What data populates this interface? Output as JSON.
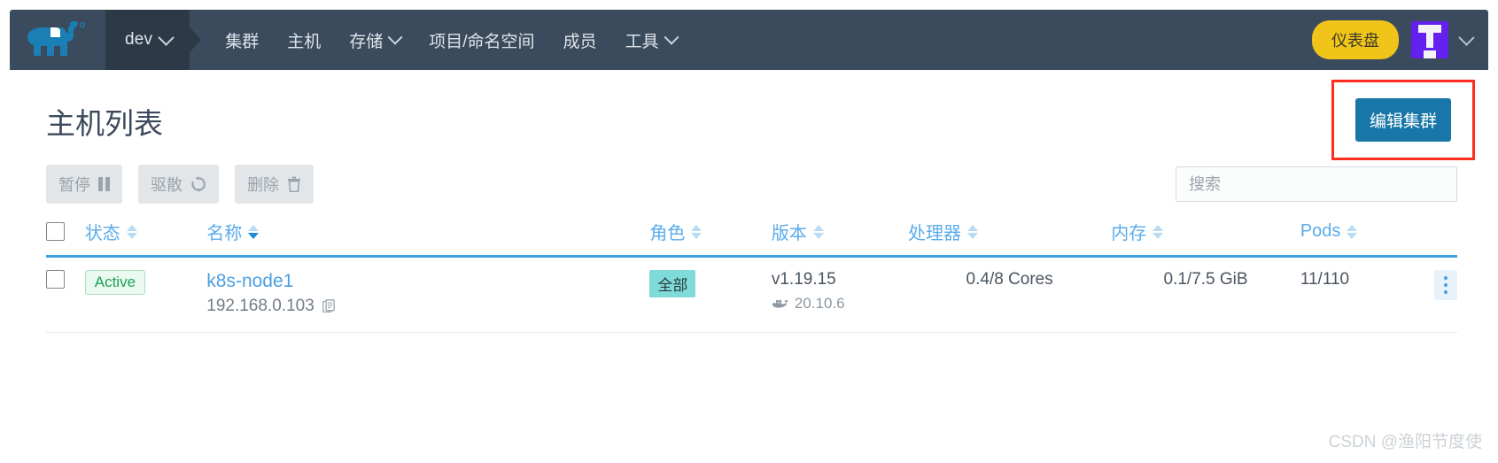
{
  "navbar": {
    "logo_name": "rancher-cow-logo",
    "context": {
      "label": "dev"
    },
    "items": [
      {
        "label": "集群",
        "has_caret": false
      },
      {
        "label": "主机",
        "has_caret": false
      },
      {
        "label": "存储",
        "has_caret": true
      },
      {
        "label": "项目/命名空间",
        "has_caret": false
      },
      {
        "label": "成员",
        "has_caret": false
      },
      {
        "label": "工具",
        "has_caret": true
      }
    ],
    "dashboard_button": "仪表盘",
    "avatar_label": "T",
    "colors": {
      "navbar_bg": "#3a4b5d",
      "context_bg": "#2c3947",
      "dashboard_bg": "#f0c419",
      "avatar_bg": "#6320ee"
    }
  },
  "page": {
    "title": "主机列表",
    "edit_cluster_button": "编辑集群",
    "highlight_color": "#ff2c1f",
    "primary_button_color": "#1877a8"
  },
  "toolbar": {
    "buttons": [
      {
        "label": "暂停",
        "icon": "pause-icon",
        "disabled": true
      },
      {
        "label": "驱散",
        "icon": "refresh-icon",
        "disabled": true
      },
      {
        "label": "删除",
        "icon": "trash-icon",
        "disabled": true
      }
    ],
    "search": {
      "value": "",
      "placeholder": "搜索"
    }
  },
  "table": {
    "columns": [
      {
        "key": "check",
        "label": "",
        "sortable": false
      },
      {
        "key": "state",
        "label": "状态",
        "sortable": true,
        "sorted": false
      },
      {
        "key": "name",
        "label": "名称",
        "sortable": true,
        "sorted": true
      },
      {
        "key": "role",
        "label": "角色",
        "sortable": true,
        "sorted": false
      },
      {
        "key": "version",
        "label": "版本",
        "sortable": true,
        "sorted": false
      },
      {
        "key": "cpu",
        "label": "处理器",
        "sortable": true,
        "sorted": false
      },
      {
        "key": "memory",
        "label": "内存",
        "sortable": true,
        "sorted": false
      },
      {
        "key": "pods",
        "label": "Pods",
        "sortable": true,
        "sorted": false
      }
    ],
    "rows": [
      {
        "selected": false,
        "state": "Active",
        "name": "k8s-node1",
        "ip": "192.168.0.103",
        "copy_icon": "copy-icon",
        "role": "全部",
        "version": "v1.19.15",
        "docker_version": "20.10.6",
        "cpu": "0.4/8 Cores",
        "memory": "0.1/7.5 GiB",
        "pods": "11/110"
      }
    ]
  },
  "watermark": "CSDN @渔阳节度使"
}
